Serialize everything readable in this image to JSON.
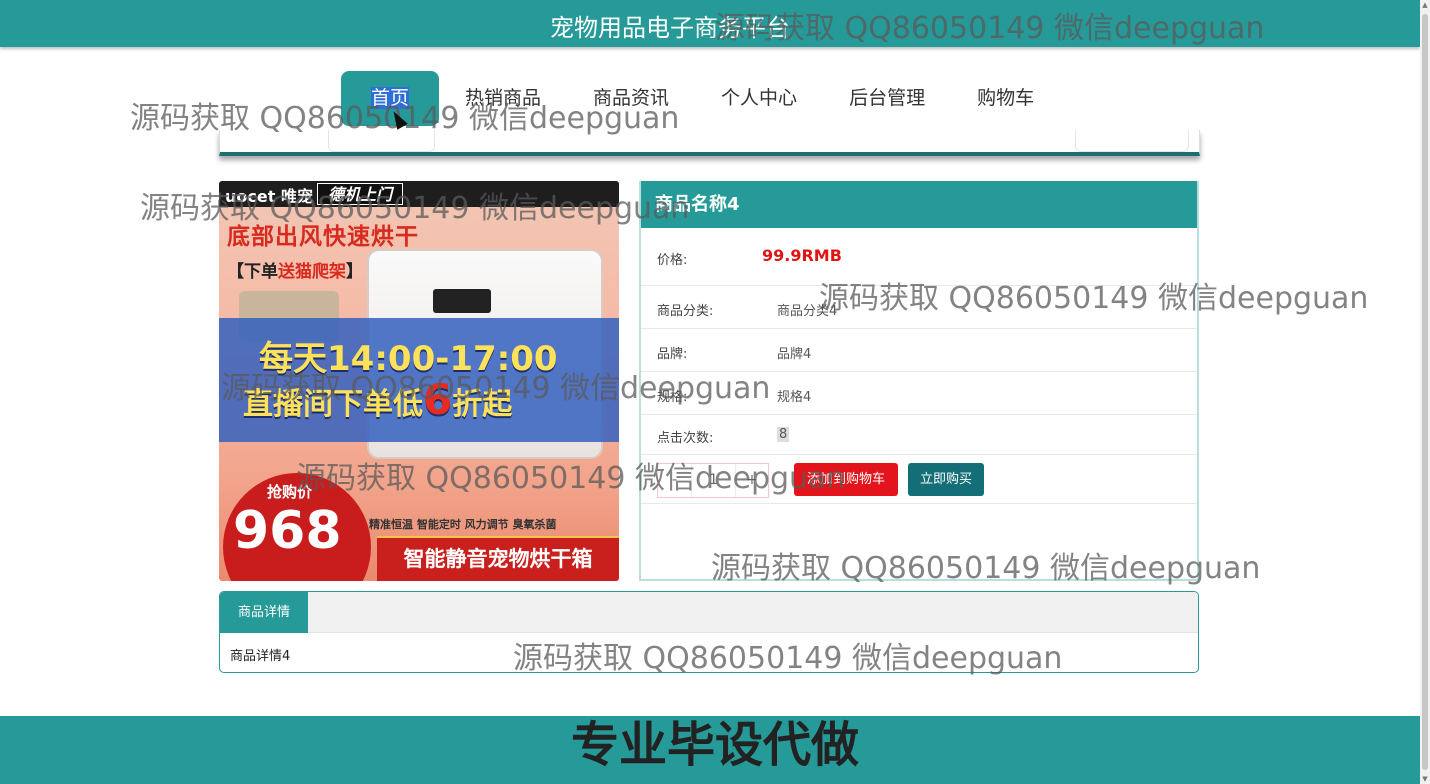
{
  "header": {
    "title": "宠物用品电子商务平台"
  },
  "nav": {
    "items": [
      {
        "label": "首页",
        "active": true
      },
      {
        "label": "热销商品"
      },
      {
        "label": "商品资讯"
      },
      {
        "label": "个人中心"
      },
      {
        "label": "后台管理"
      },
      {
        "label": "购物车"
      }
    ]
  },
  "poster": {
    "brand": "uocet 唯宠",
    "tag": "德机上门",
    "headline": "底部出风快速烘干",
    "sub_prefix": "【下单",
    "sub_highlight": "送猫爬架",
    "sub_suffix": "】",
    "live_time": "每天14:00-17:00",
    "live_pre": "直播间下单低",
    "live_num": "6",
    "live_post": "折起",
    "price_label": "抢购价",
    "price_value": "968",
    "features": "精准恒温 智能定时 风力调节 臭氧杀菌",
    "product_name": "智能静音宠物烘干箱"
  },
  "product": {
    "name": "商品名称4",
    "price_label": "价格:",
    "price_value": "99.9RMB",
    "category_label": "商品分类:",
    "category_value": "商品分类4",
    "brand_label": "品牌:",
    "brand_value": "品牌4",
    "spec_label": "规格:",
    "spec_value": "规格4",
    "hits_label": "点击次数:",
    "hits_value": "8",
    "quantity": "1",
    "minus": "-",
    "plus": "+",
    "add_to_cart": "添加到购物车",
    "buy_now": "立即购买"
  },
  "details": {
    "tab_label": "商品详情",
    "content": "商品详情4"
  },
  "footer": {
    "text": "专业毕设代做"
  },
  "watermark": {
    "text": "源码获取 QQ86050149 微信deepguan"
  },
  "colors": {
    "primary": "#269a98",
    "price": "#e01414",
    "add_button": "#e3141b",
    "buy_button": "#146e78"
  }
}
